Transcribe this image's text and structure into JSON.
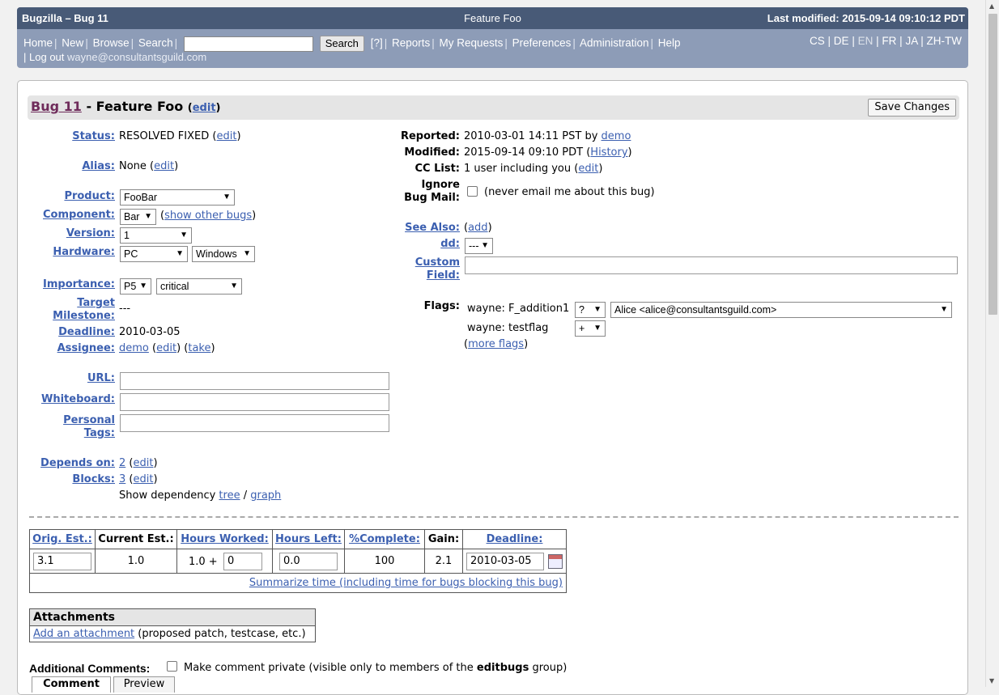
{
  "header": {
    "app": "Bugzilla – Bug 11",
    "title": "Feature Foo",
    "last_modified": "Last modified: 2015-09-14 09:10:12 PDT",
    "nav": [
      "Home",
      "New",
      "Browse",
      "Search"
    ],
    "search_button": "Search",
    "help_q": "[?]",
    "nav2": [
      "Reports",
      "My Requests",
      "Preferences",
      "Administration",
      "Help"
    ],
    "logout": "Log out",
    "user_email": "wayne@consultantsguild.com",
    "langs": [
      "CS",
      "DE",
      "EN",
      "FR",
      "JA",
      "ZH-TW"
    ]
  },
  "bug": {
    "id_link": "Bug 11",
    "title": " - Feature Foo ",
    "edit": "edit",
    "save": "Save Changes"
  },
  "left": {
    "status_label": "Status:",
    "status_value": "RESOLVED FIXED",
    "alias_label": "Alias:",
    "alias_value": "None",
    "product_label": "Product:",
    "product_value": "FooBar",
    "component_label": "Component:",
    "component_value": "Bar",
    "show_other_bugs": "show other bugs",
    "version_label": "Version:",
    "version_value": "1",
    "hardware_label": "Hardware:",
    "hardware_value": "PC",
    "os_value": "Windows",
    "importance_label": "Importance:",
    "priority_value": "P5",
    "severity_value": "critical",
    "target_label_1": "Target",
    "target_label_2": "Milestone:",
    "target_value": "---",
    "deadline_label": "Deadline:",
    "deadline_value": "2010-03-05",
    "assignee_label": "Assignee:",
    "assignee_value": "demo",
    "take": "take",
    "url_label": "URL:",
    "whiteboard_label": "Whiteboard:",
    "tags_label_1": "Personal",
    "tags_label_2": "Tags:",
    "depends_label": "Depends on:",
    "depends_value": "2",
    "blocks_label": "Blocks:",
    "blocks_value": "3",
    "show_dep": "Show dependency",
    "tree": "tree",
    "graph": "graph"
  },
  "right": {
    "reported_label": "Reported:",
    "reported_value": "2010-03-01 14:11 PST by",
    "reported_by": "demo",
    "modified_label": "Modified:",
    "modified_value": "2015-09-14 09:10 PDT",
    "history": "History",
    "cc_label": "CC List:",
    "cc_value": "1 user including you",
    "ignore_label_1": "Ignore",
    "ignore_label_2": "Bug Mail:",
    "ignore_text": "(never email me about this bug)",
    "see_also_label": "See Also:",
    "add": "add",
    "dd_label": "dd:",
    "dd_value": "---",
    "custom_label_1": "Custom",
    "custom_label_2": "Field:",
    "flags_label": "Flags:",
    "flag1_name": "wayne: F_addition1",
    "flag1_status": "?",
    "flag1_requestee": "Alice <alice@consultantsguild.com>",
    "flag2_name": "wayne: testflag",
    "flag2_status": "+",
    "more_flags": "more flags"
  },
  "time": {
    "headers": [
      "Orig. Est.:",
      "Current Est.:",
      "Hours Worked:",
      "Hours Left:",
      "%Complete:",
      "Gain:",
      "Deadline:"
    ],
    "orig_est": "3.1",
    "current_est": "1.0",
    "hours_worked_prefix": "1.0 +",
    "hours_worked_add": "0",
    "hours_left": "0.0",
    "complete": "100",
    "gain": "2.1",
    "deadline": "2010-03-05",
    "summarize": "Summarize time (including time for bugs blocking this bug)"
  },
  "attachments": {
    "header": "Attachments",
    "add": "Add an attachment",
    "hint": "(proposed patch, testcase, etc.)"
  },
  "comments": {
    "label": "Additional Comments:",
    "private_pre": "Make comment private (visible only to members of the ",
    "group": "editbugs",
    "private_post": " group)",
    "tab_comment": "Comment",
    "tab_preview": "Preview"
  }
}
